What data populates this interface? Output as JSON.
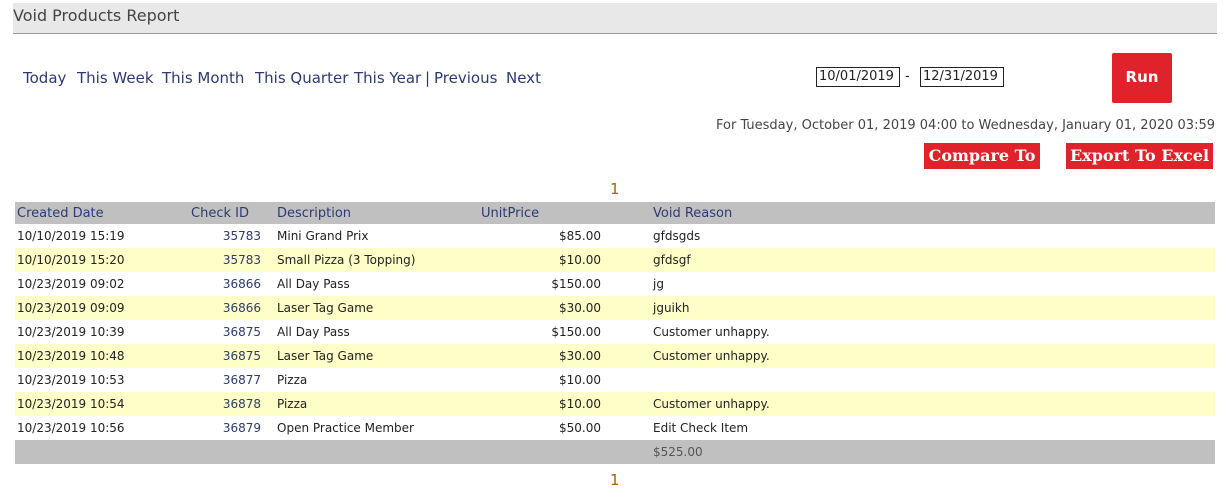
{
  "page": {
    "title": "Void Products Report"
  },
  "nav": {
    "today": "Today",
    "this_week": "This Week",
    "this_month": "This Month",
    "this_quarter": "This Quarter",
    "this_year": "This Year",
    "separator": "|",
    "previous": "Previous",
    "next": "Next"
  },
  "filters": {
    "start_date": "10/01/2019",
    "date_separator": "-",
    "end_date": "12/31/2019",
    "run_label": "Run"
  },
  "range_text": "For Tuesday, October 01, 2019 04:00 to Wednesday, January 01, 2020 03:59",
  "actions": {
    "compare_label": "Compare To",
    "export_label": "Export To Excel"
  },
  "pager": {
    "top_page": "1",
    "bottom_page": "1"
  },
  "table": {
    "headers": {
      "created_date": "Created Date",
      "check_id": "Check ID",
      "description": "Description",
      "unit_price": "UnitPrice",
      "void_reason": "Void Reason"
    },
    "rows": [
      {
        "created_date": "10/10/2019 15:19",
        "check_id": "35783",
        "description": "Mini Grand Prix",
        "unit_price": "$85.00",
        "void_reason": "gfdsgds"
      },
      {
        "created_date": "10/10/2019 15:20",
        "check_id": "35783",
        "description": "Small Pizza (3 Topping)",
        "unit_price": "$10.00",
        "void_reason": "gfdsgf"
      },
      {
        "created_date": "10/23/2019 09:02",
        "check_id": "36866",
        "description": "All Day Pass",
        "unit_price": "$150.00",
        "void_reason": "jg"
      },
      {
        "created_date": "10/23/2019 09:09",
        "check_id": "36866",
        "description": "Laser Tag Game",
        "unit_price": "$30.00",
        "void_reason": "jguikh"
      },
      {
        "created_date": "10/23/2019 10:39",
        "check_id": "36875",
        "description": "All Day Pass",
        "unit_price": "$150.00",
        "void_reason": "Customer unhappy."
      },
      {
        "created_date": "10/23/2019 10:48",
        "check_id": "36875",
        "description": "Laser Tag Game",
        "unit_price": "$30.00",
        "void_reason": "Customer unhappy."
      },
      {
        "created_date": "10/23/2019 10:53",
        "check_id": "36877",
        "description": "Pizza",
        "unit_price": "$10.00",
        "void_reason": ""
      },
      {
        "created_date": "10/23/2019 10:54",
        "check_id": "36878",
        "description": "Pizza",
        "unit_price": "$10.00",
        "void_reason": "Customer unhappy."
      },
      {
        "created_date": "10/23/2019 10:56",
        "check_id": "36879",
        "description": "Open Practice Member",
        "unit_price": "$50.00",
        "void_reason": "Edit Check Item"
      }
    ],
    "total": "$525.00"
  },
  "colors": {
    "accent_red": "#e0222a",
    "header_gray": "#c0c0c0",
    "alt_row": "#fefec8",
    "link_blue": "#2d3a72",
    "pager_orange": "#b35c00"
  }
}
